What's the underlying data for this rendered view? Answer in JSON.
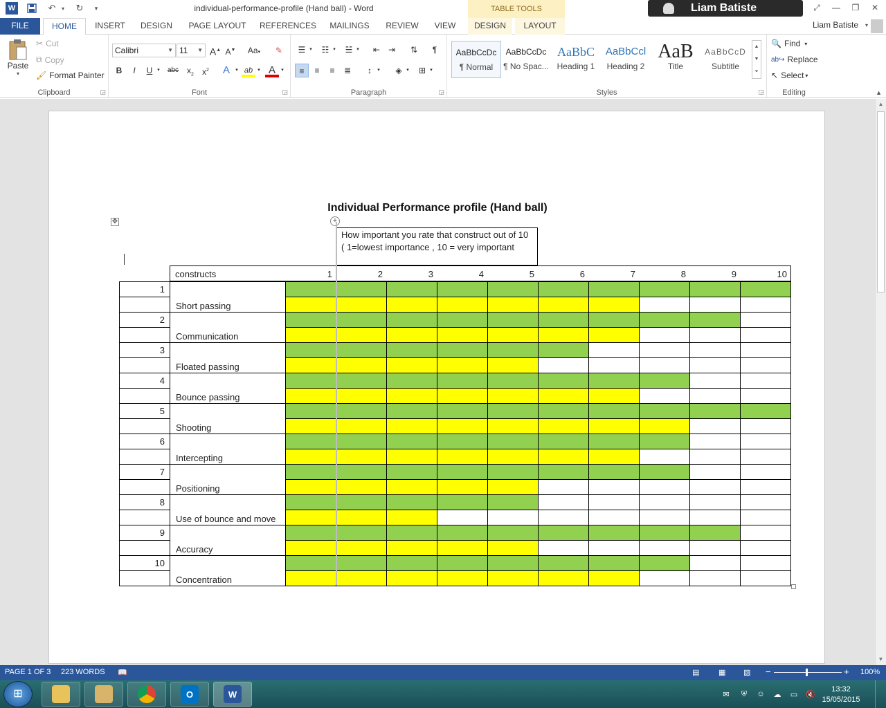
{
  "titlebar": {
    "doc_title": "individual-performance-profile (Hand ball) - Word",
    "contextual_group": "TABLE TOOLS",
    "user_chip": "Liam Batiste",
    "icons": [
      "word-app-icon",
      "save-icon",
      "undo-icon",
      "redo-icon",
      "customize-qat-icon",
      "help-icon",
      "ribbon-display-icon",
      "minimize-icon",
      "restore-icon",
      "close-icon"
    ]
  },
  "tabs": {
    "file": "FILE",
    "home": "HOME",
    "insert": "INSERT",
    "design": "DESIGN",
    "page_layout": "PAGE LAYOUT",
    "references": "REFERENCES",
    "mailings": "MAILINGS",
    "review": "REVIEW",
    "view": "VIEW",
    "table_design": "DESIGN",
    "table_layout": "LAYOUT",
    "account": "Liam Batiste"
  },
  "ribbon": {
    "clipboard": {
      "label": "Clipboard",
      "paste": "Paste",
      "cut": "Cut",
      "copy": "Copy",
      "format_painter": "Format Painter"
    },
    "font": {
      "label": "Font",
      "font_name": "Calibri",
      "font_size": "11",
      "grow": "A",
      "shrink": "A",
      "change_case": "Aa",
      "bold": "B",
      "italic": "I",
      "underline": "U",
      "strike": "abc",
      "subscript": "x",
      "superscript": "x",
      "text_effects": "A",
      "highlight": "ab",
      "font_color": "A"
    },
    "paragraph": {
      "label": "Paragraph",
      "pilcrow": "¶"
    },
    "styles": {
      "label": "Styles",
      "items": [
        {
          "sample": "AaBbCcDc",
          "name": "¶ Normal"
        },
        {
          "sample": "AaBbCcDc",
          "name": "¶ No Spac..."
        },
        {
          "sample": "AaBbC",
          "name": "Heading 1"
        },
        {
          "sample": "AaBbCcl",
          "name": "Heading 2"
        },
        {
          "sample": "AaB",
          "name": "Title"
        },
        {
          "sample": "AaBbCcD",
          "name": "Subtitle"
        }
      ]
    },
    "editing": {
      "label": "Editing",
      "find": "Find",
      "replace": "Replace",
      "select": "Select"
    }
  },
  "document": {
    "heading": "Individual Performance profile (Hand ball)",
    "rating_note": "How important you rate that construct out of 10 ( 1=lowest importance , 10 = very important",
    "header_label": "constructs",
    "scale": [
      "1",
      "2",
      "3",
      "4",
      "5",
      "6",
      "7",
      "8",
      "9",
      "10"
    ],
    "colors": {
      "green": "#92d050",
      "yellow": "#ffff00"
    },
    "constructs": [
      {
        "num": "1",
        "name": "Short passing",
        "green": 10,
        "yellow": 7
      },
      {
        "num": "2",
        "name": "Communication",
        "green": 9,
        "yellow": 7
      },
      {
        "num": "3",
        "name": "Floated passing",
        "green": 6,
        "yellow": 5
      },
      {
        "num": "4",
        "name": "Bounce passing",
        "green": 8,
        "yellow": 7
      },
      {
        "num": "5",
        "name": "Shooting",
        "green": 10,
        "yellow": 8
      },
      {
        "num": "6",
        "name": "Intercepting",
        "green": 8,
        "yellow": 7
      },
      {
        "num": "7",
        "name": "Positioning",
        "green": 8,
        "yellow": 5
      },
      {
        "num": "8",
        "name": "Use of bounce and move",
        "green": 5,
        "yellow": 3
      },
      {
        "num": "9",
        "name": "Accuracy",
        "green": 9,
        "yellow": 5
      },
      {
        "num": "10",
        "name": "Concentration",
        "green": 8,
        "yellow": 7
      }
    ]
  },
  "statusbar": {
    "page": "PAGE 1 OF 3",
    "words": "223 WORDS",
    "zoom": "100%"
  },
  "taskbar": {
    "apps": [
      "file-explorer",
      "user-app",
      "chrome",
      "outlook",
      "word"
    ],
    "time": "13:32",
    "date": "15/05/2015"
  }
}
